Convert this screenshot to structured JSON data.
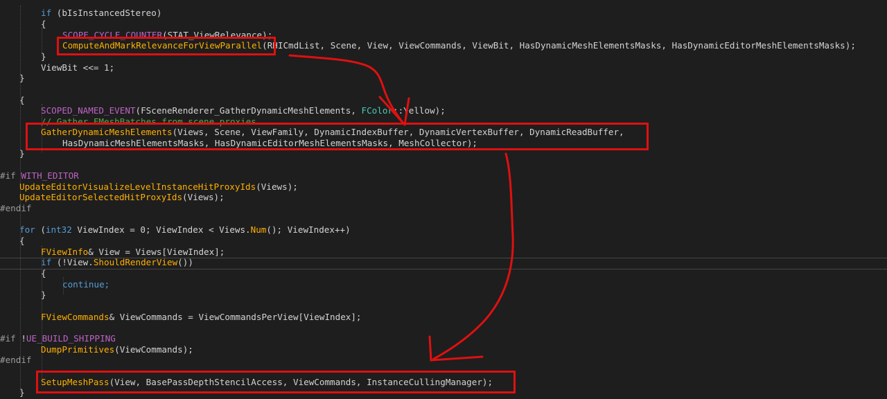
{
  "code": {
    "l1": {
      "kw": "if",
      "rest": " (bIsInstancedStereo)"
    },
    "l2": "{",
    "l3": {
      "macro": "SCOPE_CYCLE_COUNTER",
      "rest": "(STAT_ViewRelevance);"
    },
    "l4": {
      "fn": "ComputeAndMarkRelevanceForViewParallel",
      "rest": "(RHICmdList, Scene, View, ViewCommands, ViewBit, HasDynamicMeshElementsMasks, HasDynamicEditorMeshElementsMasks);"
    },
    "l5": "}",
    "l6": "ViewBit <<= 1;",
    "l7": "}",
    "l8": "{",
    "l9": {
      "macro": "SCOPED_NAMED_EVENT",
      "rest1": "(FSceneRenderer_GatherDynamicMeshElements, ",
      "type": "FColor",
      "rest2": "::Yellow);"
    },
    "l10": "// Gather FMeshBatches from scene proxies",
    "l11": {
      "fn": "GatherDynamicMeshElements",
      "rest": "(Views, Scene, ViewFamily, DynamicIndexBuffer, DynamicVertexBuffer, DynamicReadBuffer,"
    },
    "l12": "HasDynamicMeshElementsMasks, HasDynamicEditorMeshElementsMasks, MeshCollector);",
    "l13": "}",
    "l14": {
      "pp": "#if",
      "macro": "WITH_EDITOR"
    },
    "l15": {
      "fn": "UpdateEditorVisualizeLevelInstanceHitProxyIds",
      "rest": "(Views);"
    },
    "l16": {
      "fn": "UpdateEditorSelectedHitProxyIds",
      "rest": "(Views);"
    },
    "l17": "#endif",
    "l18": {
      "kw": "for",
      "p1": " (",
      "kw2": "int32",
      "rest": " ViewIndex = 0; ViewIndex < Views.",
      "fn": "Num",
      "rest2": "(); ViewIndex++)"
    },
    "l19": "{",
    "l20": {
      "type": "FViewInfo",
      "rest": "& View = Views[ViewIndex];"
    },
    "l21": {
      "kw": "if",
      "p1": " (!View.",
      "fn": "ShouldRenderView",
      "rest": "())"
    },
    "l22": "{",
    "l23": "continue;",
    "l24": "}",
    "l25": {
      "type": "FViewCommands",
      "rest": "& ViewCommands = ViewCommandsPerView[ViewIndex];"
    },
    "l26": {
      "pp": "#if",
      "rest": " !",
      "macro": "UE_BUILD_SHIPPING"
    },
    "l27": {
      "fn": "DumpPrimitives",
      "rest": "(ViewCommands);"
    },
    "l28": "#endif",
    "l29": {
      "fn": "SetupMeshPass",
      "rest": "(View, BasePassDepthStencilAccess, ViewCommands, InstanceCullingManager);"
    },
    "l30": "}"
  },
  "colors": {
    "annotation": "#e01010",
    "background": "#1e1e1e"
  }
}
